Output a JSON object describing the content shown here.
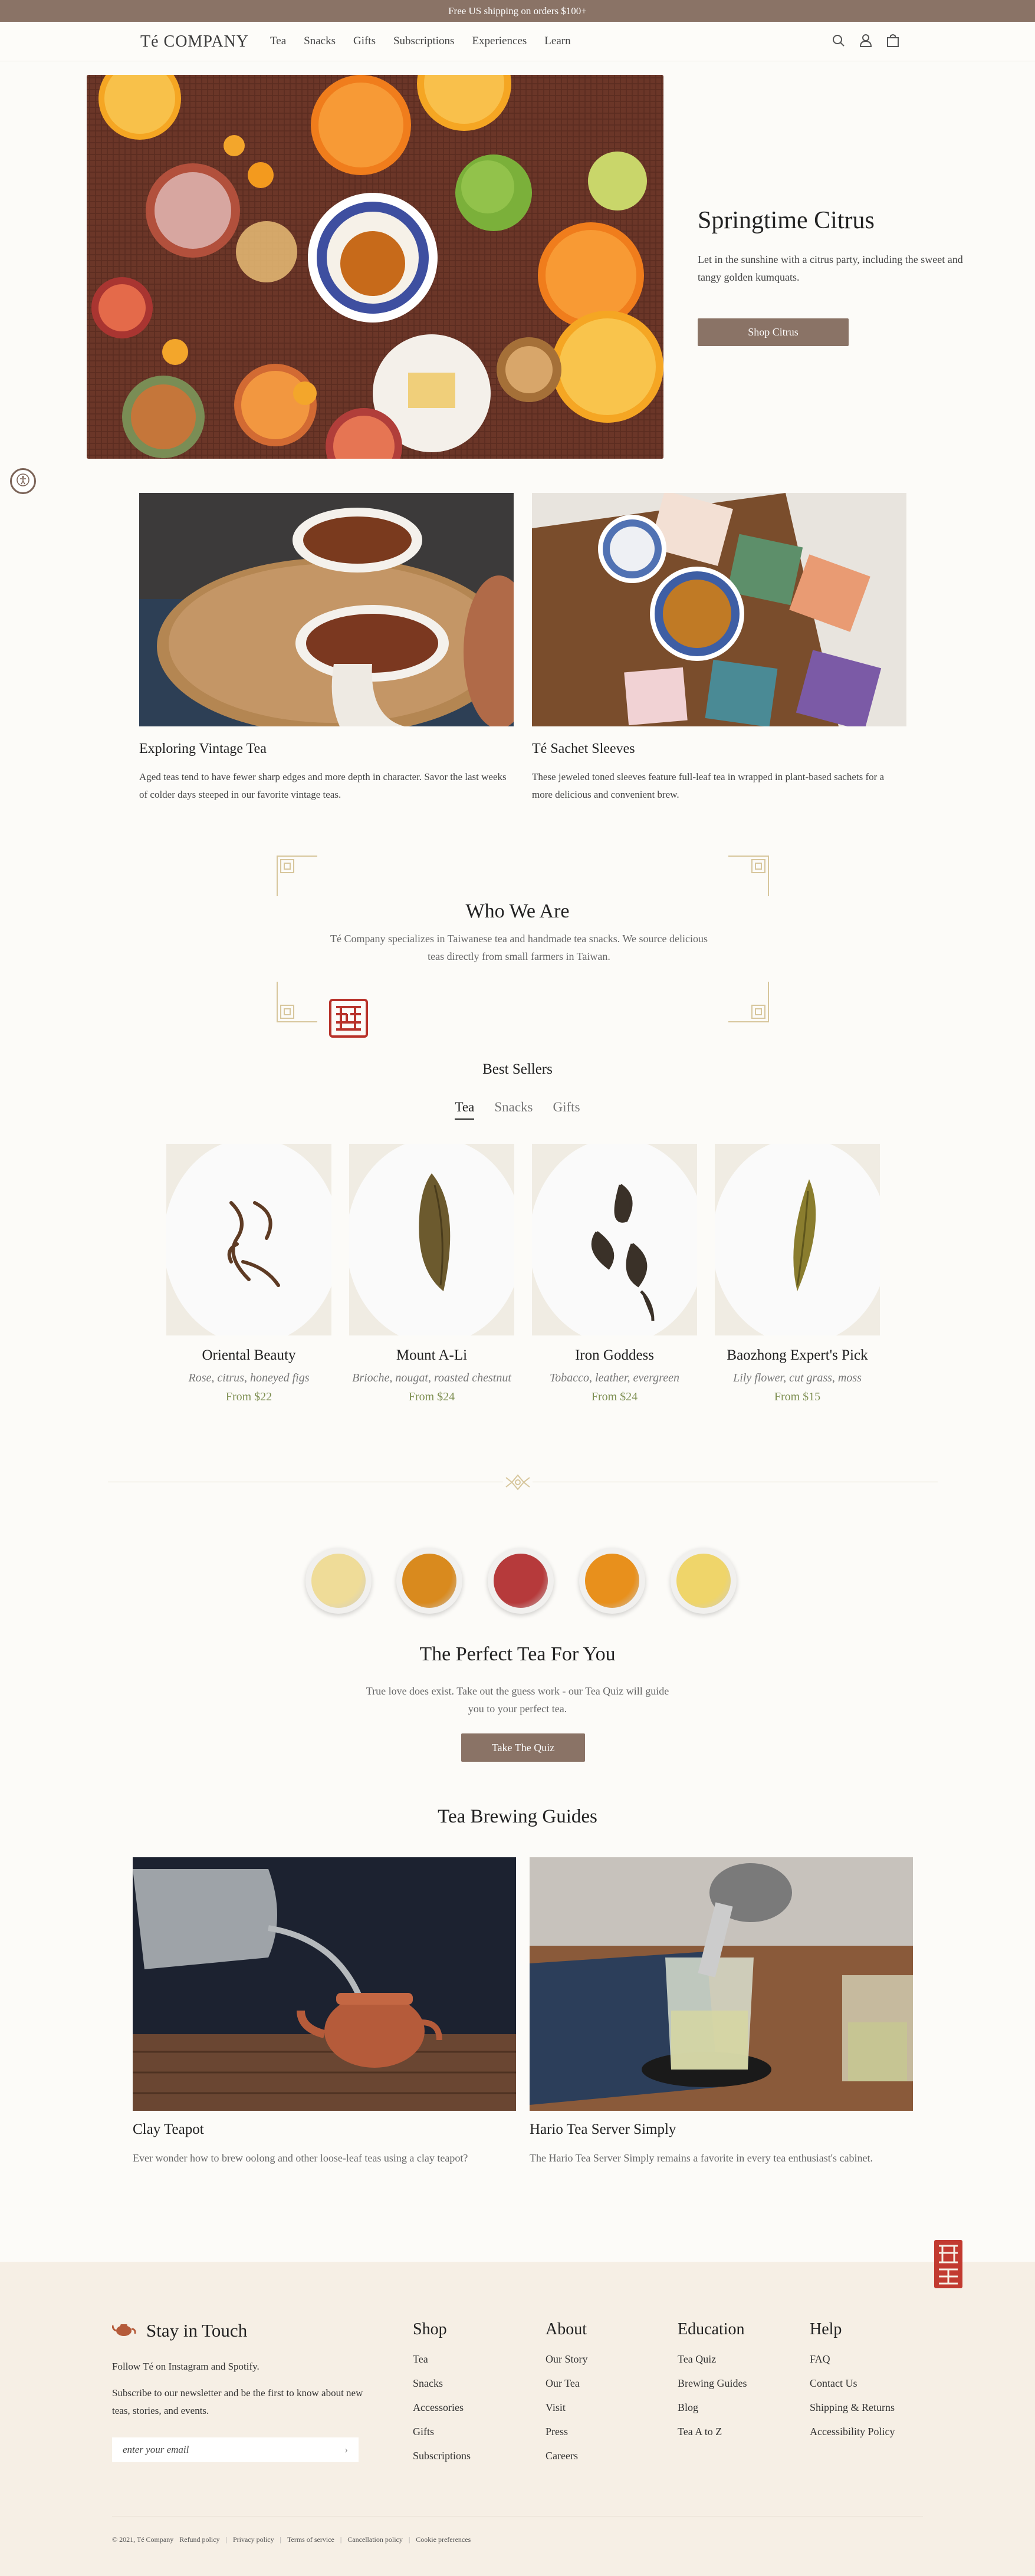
{
  "announcement": "Free US shipping on orders $100+",
  "header": {
    "logo": "Té COMPANY",
    "nav": [
      "Tea",
      "Snacks",
      "Gifts",
      "Subscriptions",
      "Experiences",
      "Learn"
    ],
    "icons": [
      "search-icon",
      "account-icon",
      "bag-icon"
    ]
  },
  "hero": {
    "title": "Springtime Citrus",
    "text": "Let in the sunshine with a citrus party, including the sweet and tangy golden kumquats.",
    "button": "Shop Citrus"
  },
  "features": [
    {
      "title": "Exploring Vintage Tea",
      "text": "Aged teas tend to have fewer sharp edges and more depth in character. Savor the last weeks of colder days steeped in our favorite vintage teas."
    },
    {
      "title": "Té Sachet Sleeves",
      "text": "These jeweled toned sleeves feature full-leaf tea in wrapped in plant-based sachets for a more delicious and convenient brew."
    }
  ],
  "who": {
    "title": "Who We Are",
    "text": "Té Company specializes in Taiwanese tea and handmade tea snacks. We source delicious teas directly from small farmers in Taiwan."
  },
  "best_sellers": {
    "title": "Best Sellers",
    "tabs": [
      "Tea",
      "Snacks",
      "Gifts"
    ],
    "active_tab": "Tea",
    "products": [
      {
        "name": "Oriental Beauty",
        "notes": "Rose, citrus, honeyed figs",
        "price": "From $22"
      },
      {
        "name": "Mount A-Li",
        "notes": "Brioche, nougat, roasted chestnut",
        "price": "From $24"
      },
      {
        "name": "Iron Goddess",
        "notes": "Tobacco, leather, evergreen",
        "price": "From $24"
      },
      {
        "name": "Baozhong Expert's Pick",
        "notes": "Lily flower, cut grass, moss",
        "price": "From $15"
      }
    ]
  },
  "quiz": {
    "cup_colors": [
      "#efdc98",
      "#d98a1e",
      "#b63a3b",
      "#e8901c",
      "#efd56a"
    ],
    "title": "The Perfect Tea For You",
    "text": "True love does exist. Take out the guess work - our Tea Quiz will guide you to your perfect tea.",
    "button": "Take The Quiz"
  },
  "guides": {
    "title": "Tea Brewing Guides",
    "items": [
      {
        "title": "Clay Teapot",
        "text": "Ever wonder how to brew oolong and other loose-leaf teas using a clay teapot?"
      },
      {
        "title": "Hario Tea Server Simply",
        "text": "The Hario Tea Server Simply remains a favorite in every tea enthusiast's cabinet."
      }
    ]
  },
  "footer": {
    "stay_title": "Stay in Touch",
    "follow": "Follow Té on Instagram and Spotify.",
    "subscribe": "Subscribe to our newsletter and be the first to know about new teas, stories, and events.",
    "email_placeholder": "enter your email",
    "columns": [
      {
        "title": "Shop",
        "links": [
          "Tea",
          "Snacks",
          "Accessories",
          "Gifts",
          "Subscriptions"
        ]
      },
      {
        "title": "About",
        "links": [
          "Our Story",
          "Our Tea",
          "Visit",
          "Press",
          "Careers"
        ]
      },
      {
        "title": "Education",
        "links": [
          "Tea Quiz",
          "Brewing Guides",
          "Blog",
          "Tea A to Z"
        ]
      },
      {
        "title": "Help",
        "links": [
          "FAQ",
          "Contact Us",
          "Shipping & Returns",
          "Accessibility Policy"
        ]
      }
    ],
    "copyright": "© 2021, Té Company",
    "legal": [
      "Refund policy",
      "Privacy policy",
      "Terms of service",
      "Cancellation policy",
      "Cookie preferences"
    ]
  },
  "colors": {
    "accent": "#8a7366",
    "price": "#7e8f52",
    "footer_bg": "#f6efe5",
    "seal": "#b8322a"
  }
}
